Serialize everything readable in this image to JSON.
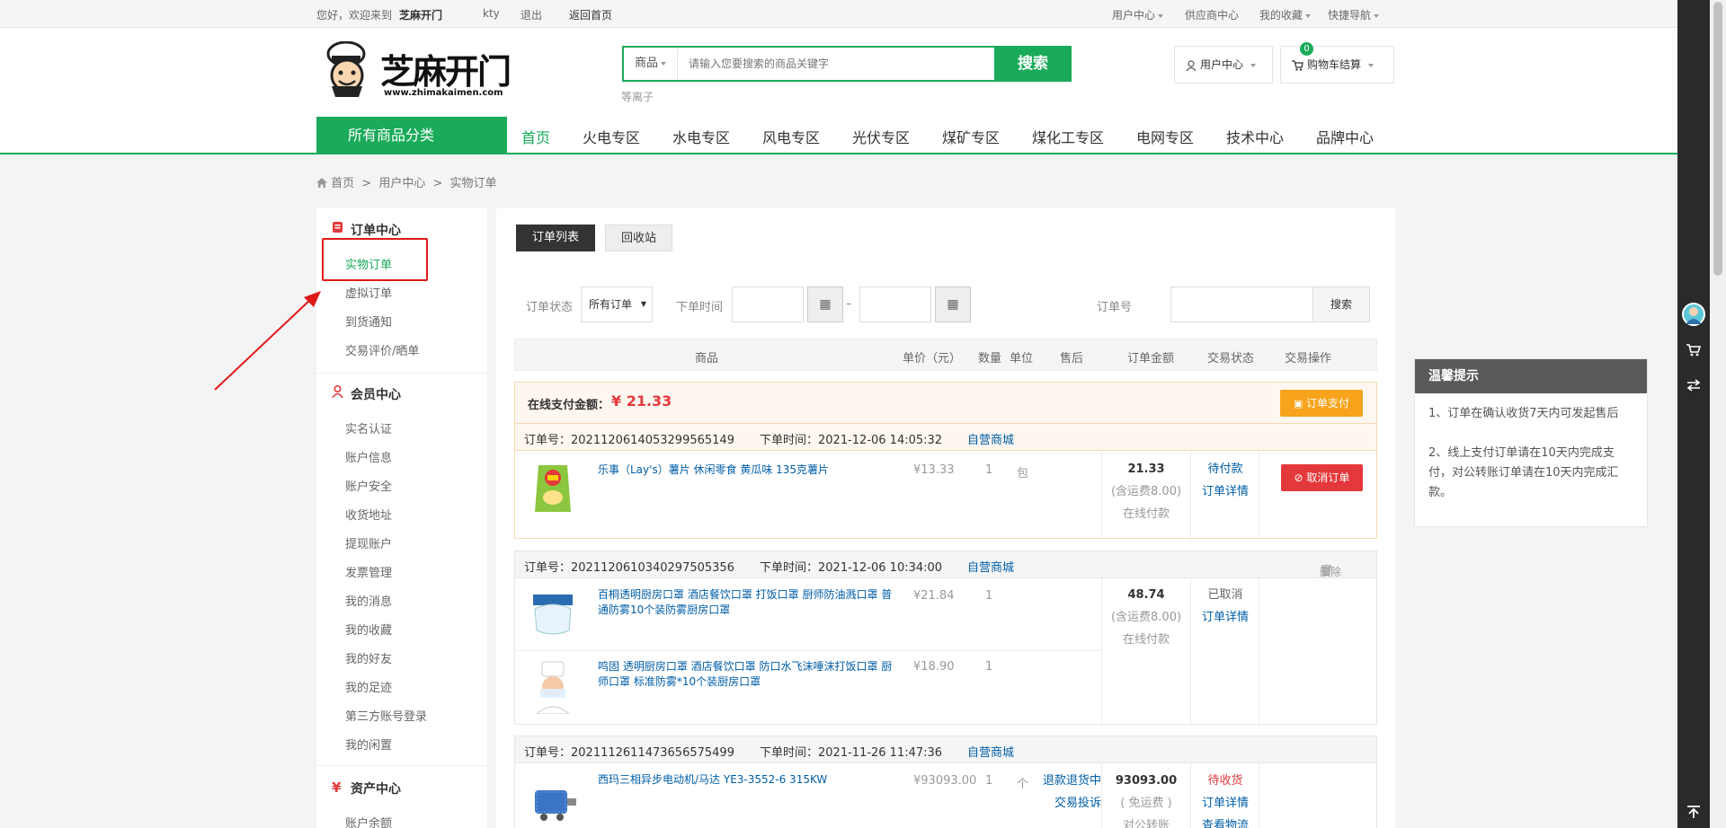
{
  "topbar": {
    "welcome": "您好，欢迎来到",
    "site": "芝麻开门",
    "user": "kty",
    "logout": "退出",
    "home": "返回首页",
    "user_center": "用户中心",
    "supplier_center": "供应商中心",
    "favorites": "我的收藏",
    "quick_nav": "快捷导航"
  },
  "header": {
    "logo_text": "芝麻开门",
    "logo_url": "www.zhimakaimen.com",
    "search_category": "商品",
    "search_placeholder": "请输入您要搜索的商品关键字",
    "search_button": "搜索",
    "hot_word": "等离子",
    "user_center_button": "用户中心",
    "cart_button": "购物车结算",
    "cart_count": "0"
  },
  "nav": {
    "all_categories": "所有商品分类",
    "items": [
      "首页",
      "火电专区",
      "水电专区",
      "风电专区",
      "光伏专区",
      "煤矿专区",
      "煤化工专区",
      "电网专区",
      "技术中心",
      "品牌中心"
    ]
  },
  "breadcrumb": {
    "home": "首页",
    "level1": "用户中心",
    "level2": "实物订单",
    "sep": ">"
  },
  "sidebar": {
    "order_center": {
      "title": "订单中心",
      "items": [
        "实物订单",
        "虚拟订单",
        "到货通知",
        "交易评价/晒单"
      ]
    },
    "member_center": {
      "title": "会员中心",
      "items": [
        "实名认证",
        "账户信息",
        "账户安全",
        "收货地址",
        "提现账户",
        "发票管理",
        "我的消息",
        "我的收藏",
        "我的好友",
        "我的足迹",
        "第三方账号登录",
        "我的闲置"
      ]
    },
    "asset_center": {
      "title": "资产中心",
      "items": [
        "账户余额"
      ]
    }
  },
  "main": {
    "tabs": [
      "订单列表",
      "回收站"
    ],
    "filter": {
      "status_label": "订单状态",
      "status_value": "所有订单",
      "time_label": "下单时间",
      "dash": "–",
      "order_no_label": "订单号",
      "search_button": "搜索"
    },
    "table_headers": [
      "商品",
      "单价（元）",
      "数量",
      "单位",
      "售后",
      "订单金额",
      "交易状态",
      "交易操作"
    ],
    "pay_bar": {
      "label": "在线支付金额：",
      "amount": "¥ 21.33",
      "pay_button": "订单支付"
    },
    "orders": [
      {
        "order_no": "订单号：2021120614053299565149",
        "order_time": "下单时间：2021-12-06 14:05:32",
        "shop": "自营商城",
        "products": [
          {
            "name": "乐事（Lay's）薯片 休闲零食 黄瓜味 135克薯片",
            "price": "¥13.33",
            "qty": "1",
            "unit": "包"
          }
        ],
        "amount": "21.33",
        "shipping": "(含运费8.00)",
        "pay_method": "在线付款",
        "status": "待付款",
        "detail": "订单详情",
        "action": "取消订单"
      },
      {
        "order_no": "订单号：2021120610340297505356",
        "order_time": "下单时间：2021-12-06 10:34:00",
        "shop": "自营商城",
        "delete": "删除",
        "products": [
          {
            "name": "百桐透明厨房口罩 酒店餐饮口罩 打饭口罩 厨师防油溅口罩 普通防雾10个装防雾厨房口罩",
            "price": "¥21.84",
            "qty": "1",
            "unit": ""
          },
          {
            "name": "鸣固 透明厨房口罩 酒店餐饮口罩 防口水飞沫唾沫打饭口罩 厨师口罩 标准防雾*10个装厨房口罩",
            "price": "¥18.90",
            "qty": "1",
            "unit": ""
          }
        ],
        "amount": "48.74",
        "shipping": "(含运费8.00)",
        "pay_method": "在线付款",
        "status": "已取消",
        "detail": "订单详情"
      },
      {
        "order_no": "订单号：2021112611473656575499",
        "order_time": "下单时间：2021-11-26 11:47:36",
        "shop": "自营商城",
        "products": [
          {
            "name": "西玛三相异步电动机/马达 YE3-3552-6 315KW",
            "price": "¥93093.00",
            "qty": "1",
            "unit": "个"
          }
        ],
        "after_sale": "退款退货中",
        "complaint": "交易投诉",
        "amount": "93093.00",
        "shipping": "( 免运费 )",
        "pay_method": "对公转账",
        "status": "待收货",
        "detail": "订单详情",
        "logistics": "查看物流"
      }
    ]
  },
  "tips": {
    "title": "温馨提示",
    "items": [
      "1、订单在确认收货7天内可发起售后",
      "2、线上支付订单请在10天内完成支付，对公转账订单请在10天内完成汇款。"
    ]
  },
  "colors": {
    "brand_green": "#1aab5a",
    "price_red": "#e4393c",
    "link_blue": "#005ea7",
    "pay_orange": "#f7a31b",
    "annotation_red": "#e01818"
  }
}
